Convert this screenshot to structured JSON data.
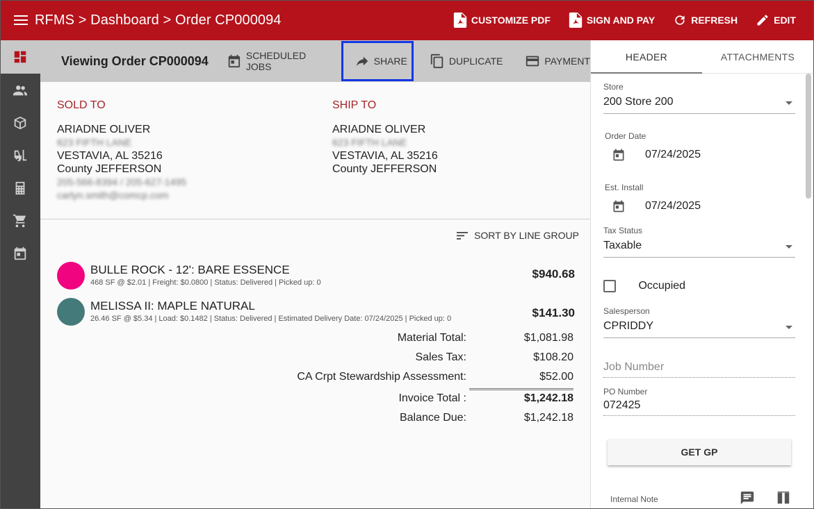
{
  "topbar": {
    "breadcrumb": "RFMS > Dashboard > Order CP000094",
    "actions": {
      "customize_pdf": "CUSTOMIZE PDF",
      "sign_and_pay": "SIGN AND PAY",
      "refresh": "REFRESH",
      "edit": "EDIT"
    }
  },
  "leftnav": {
    "items": [
      "dashboard-icon",
      "people-icon",
      "box-icon",
      "forklift-icon",
      "calculator-icon",
      "cart-icon",
      "calendar-icon"
    ]
  },
  "toolbar": {
    "title": "Viewing Order CP000094",
    "scheduled_jobs": "SCHEDULED JOBS",
    "share": "SHARE",
    "duplicate": "DUPLICATE",
    "payment": "PAYMENT"
  },
  "sold_to": {
    "heading": "SOLD TO",
    "name": "ARIADNE OLIVER",
    "street": "623 FIFTH LANE",
    "city": "VESTAVIA, AL 35216",
    "county": "County JEFFERSON",
    "phone": "205-566-8394 / 205-627-1495",
    "email": "carlyn.smith@comcp.com"
  },
  "ship_to": {
    "heading": "SHIP TO",
    "name": "ARIADNE OLIVER",
    "street": "623 FIFTH LANE",
    "city": "VESTAVIA, AL 35216",
    "county": "County JEFFERSON"
  },
  "sort": {
    "label": "SORT BY LINE GROUP"
  },
  "line_items": [
    {
      "color": "#f0047f",
      "name": "BULLE ROCK - 12': BARE ESSENCE",
      "detail": "468 SF @ $2.01  |  Freight: $0.0800  |  Status: Delivered  |  Picked up: 0",
      "price": "$940.68"
    },
    {
      "color": "#447a7a",
      "name": "MELISSA II: MAPLE NATURAL",
      "detail": "26.46 SF @ $5.34  |  Load: $0.1482  |  Status: Delivered  |  Estimated Delivery Date: 07/24/2025  |  Picked up: 0",
      "price": "$141.30"
    }
  ],
  "totals": {
    "material_label": "Material Total:",
    "material_value": "$1,081.98",
    "tax_label": "Sales Tax:",
    "tax_value": "$108.20",
    "ca_label": "CA Crpt Stewardship Assessment:",
    "ca_value": "$52.00",
    "invoice_label": "Invoice Total :",
    "invoice_value": "$1,242.18",
    "balance_label": "Balance Due:",
    "balance_value": "$1,242.18"
  },
  "rpanel": {
    "tabs": [
      "HEADER",
      "ATTACHMENTS"
    ],
    "store_label": "Store",
    "store_value": "200 Store 200",
    "order_date_label": "Order Date",
    "order_date_value": "07/24/2025",
    "est_install_label": "Est. Install",
    "est_install_value": "07/24/2025",
    "tax_status_label": "Tax Status",
    "tax_status_value": "Taxable",
    "occupied_label": "Occupied",
    "salesperson_label": "Salesperson",
    "salesperson_value": "CPRIDDY",
    "job_number_placeholder": "Job Number",
    "po_label": "PO Number",
    "po_value": "072425",
    "get_gp": "GET GP",
    "internal_note_label": "Internal Note"
  },
  "colors": {
    "brand_red": "#b5121b",
    "nav_dark": "#424242",
    "highlight_blue": "#1436e6"
  }
}
